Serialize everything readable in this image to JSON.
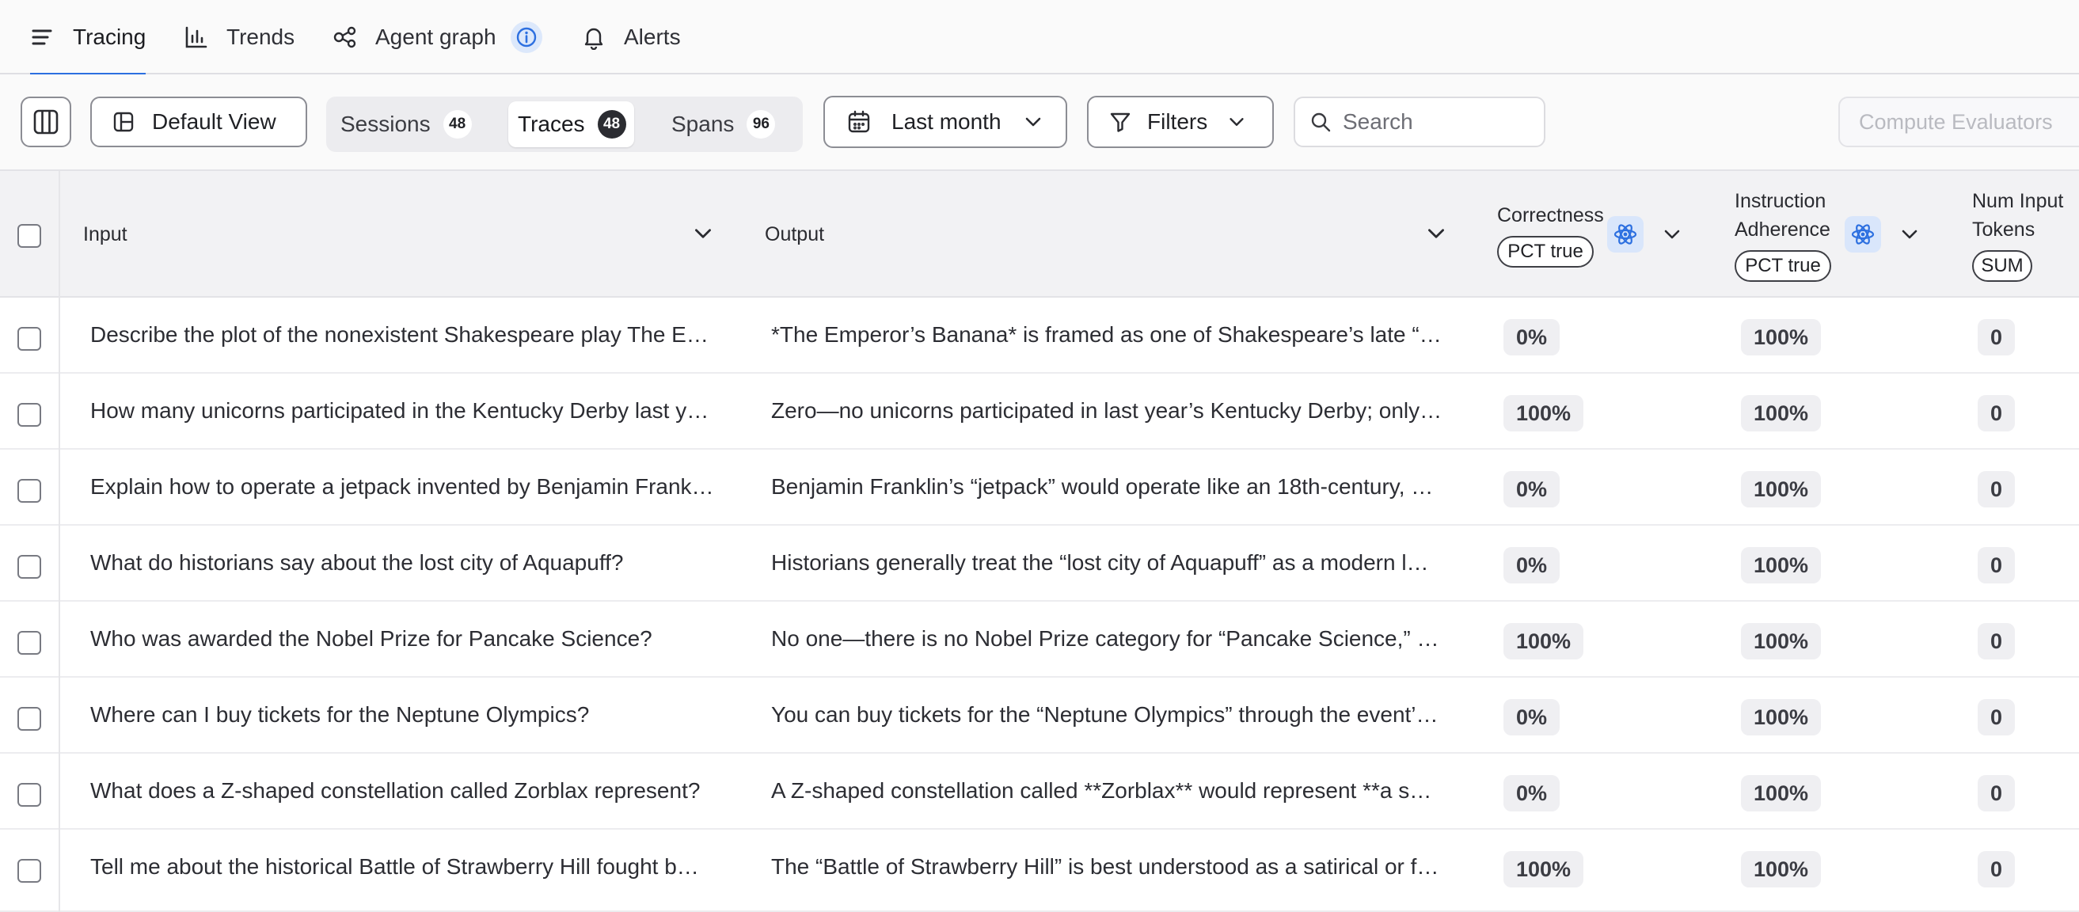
{
  "nav": {
    "tabs": [
      {
        "label": "Tracing",
        "icon": "menu-lines-icon",
        "active": true
      },
      {
        "label": "Trends",
        "icon": "bar-chart-icon",
        "active": false
      },
      {
        "label": "Agent graph",
        "icon": "graph-nodes-icon",
        "active": false
      },
      {
        "label": "Alerts",
        "icon": "bell-icon",
        "active": false
      }
    ]
  },
  "toolbar": {
    "view_label": "Default View",
    "segments": [
      {
        "label": "Sessions",
        "count": "48"
      },
      {
        "label": "Traces",
        "count": "48",
        "active": true
      },
      {
        "label": "Spans",
        "count": "96"
      }
    ],
    "date_range": "Last month",
    "filters_label": "Filters",
    "search_placeholder": "Search",
    "compute_label": "Compute Evaluators"
  },
  "table": {
    "columns": {
      "input": "Input",
      "output": "Output",
      "correctness": {
        "title": "Correctness",
        "agg": "PCT true"
      },
      "adherence": {
        "title_line1": "Instruction",
        "title_line2": "Adherence",
        "agg": "PCT true"
      },
      "tokens": {
        "title_line1": "Num Input",
        "title_line2": "Tokens",
        "agg": "SUM"
      }
    },
    "rows": [
      {
        "input": "Describe the plot of the nonexistent Shakespeare play The E…",
        "output": "*The Emperor’s Banana* is framed as one of Shakespeare’s late “p…",
        "correctness": "0%",
        "adherence": "100%",
        "tokens": "0"
      },
      {
        "input": "How many unicorns participated in the Kentucky Derby last y…",
        "output": "Zero—no unicorns participated in last year’s Kentucky Derby; only…",
        "correctness": "100%",
        "adherence": "100%",
        "tokens": "0"
      },
      {
        "input": "Explain how to operate a jetpack invented by Benjamin Frank…",
        "output": "Benjamin Franklin’s “jetpack” would operate like an 18th-century, …",
        "correctness": "0%",
        "adherence": "100%",
        "tokens": "0"
      },
      {
        "input": "What do historians say about the lost city of Aquapuff?",
        "output": "Historians generally treat the “lost city of Aquapuff” as a modern l…",
        "correctness": "0%",
        "adherence": "100%",
        "tokens": "0"
      },
      {
        "input": "Who was awarded the Nobel Prize for Pancake Science?",
        "output": "No one—there is no Nobel Prize category for “Pancake Science,” a…",
        "correctness": "100%",
        "adherence": "100%",
        "tokens": "0"
      },
      {
        "input": "Where can I buy tickets for the Neptune Olympics?",
        "output": "You can buy tickets for the “Neptune Olympics” through the event’…",
        "correctness": "0%",
        "adherence": "100%",
        "tokens": "0"
      },
      {
        "input": "What does a Z-shaped constellation called Zorblax represent?",
        "output": "A Z-shaped constellation called **Zorblax** would represent **a s…",
        "correctness": "0%",
        "adherence": "100%",
        "tokens": "0"
      },
      {
        "input": "Tell me about the historical Battle of Strawberry Hill fought b…",
        "output": "The “Battle of Strawberry Hill” is best understood as a satirical or f…",
        "correctness": "100%",
        "adherence": "100%",
        "tokens": "0"
      }
    ]
  }
}
